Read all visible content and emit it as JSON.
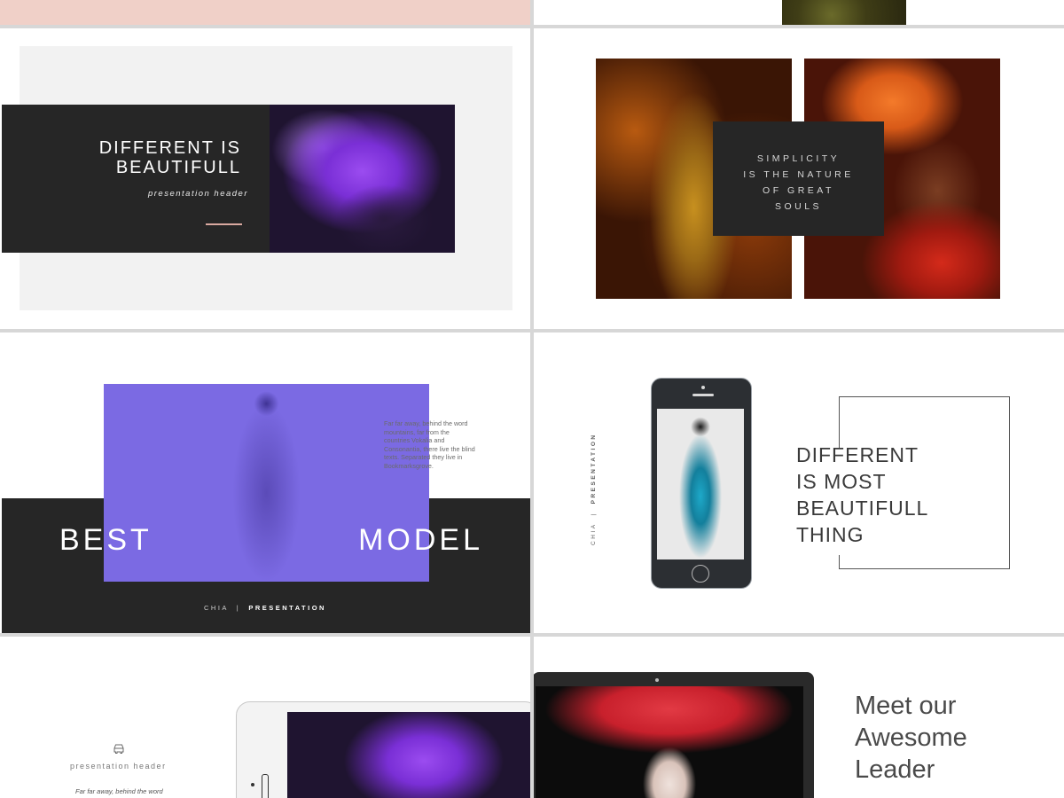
{
  "slide_different": {
    "title": "DIFFERENT IS\nBEAUTIFULL",
    "subtitle": "presentation header"
  },
  "slide_simplicity": {
    "quote": "SIMPLICITY\nIS THE NATURE\nOF GREAT\nSOULS"
  },
  "slide_best_model": {
    "word_left": "BEST",
    "word_right": "MODEL",
    "paragraph": "Far far away, behind the word mountains, far from the countries Vokalia and Consonantia, there live the blind texts. Separated they live in Bookmarksgrove.",
    "footer_left": "CHIA",
    "footer_sep": "|",
    "footer_right": "PRESENTATION"
  },
  "slide_phone": {
    "vertical_left": "CHIA",
    "vertical_sep": "|",
    "vertical_right": "PRESENTATION",
    "headline": "DIFFERENT\nIS MOST\nBEAUTIFULL\nTHING"
  },
  "slide_tablet": {
    "icon": "car-icon",
    "header": "presentation header",
    "paragraph": "Far far away, behind the word"
  },
  "slide_laptop": {
    "headline": "Meet our\nAwesome\nLeader"
  },
  "colors": {
    "dark": "#262626",
    "purple": "#7b6ae3",
    "pink": "#f0d0c8",
    "accent_line": "#d9a9a0"
  }
}
